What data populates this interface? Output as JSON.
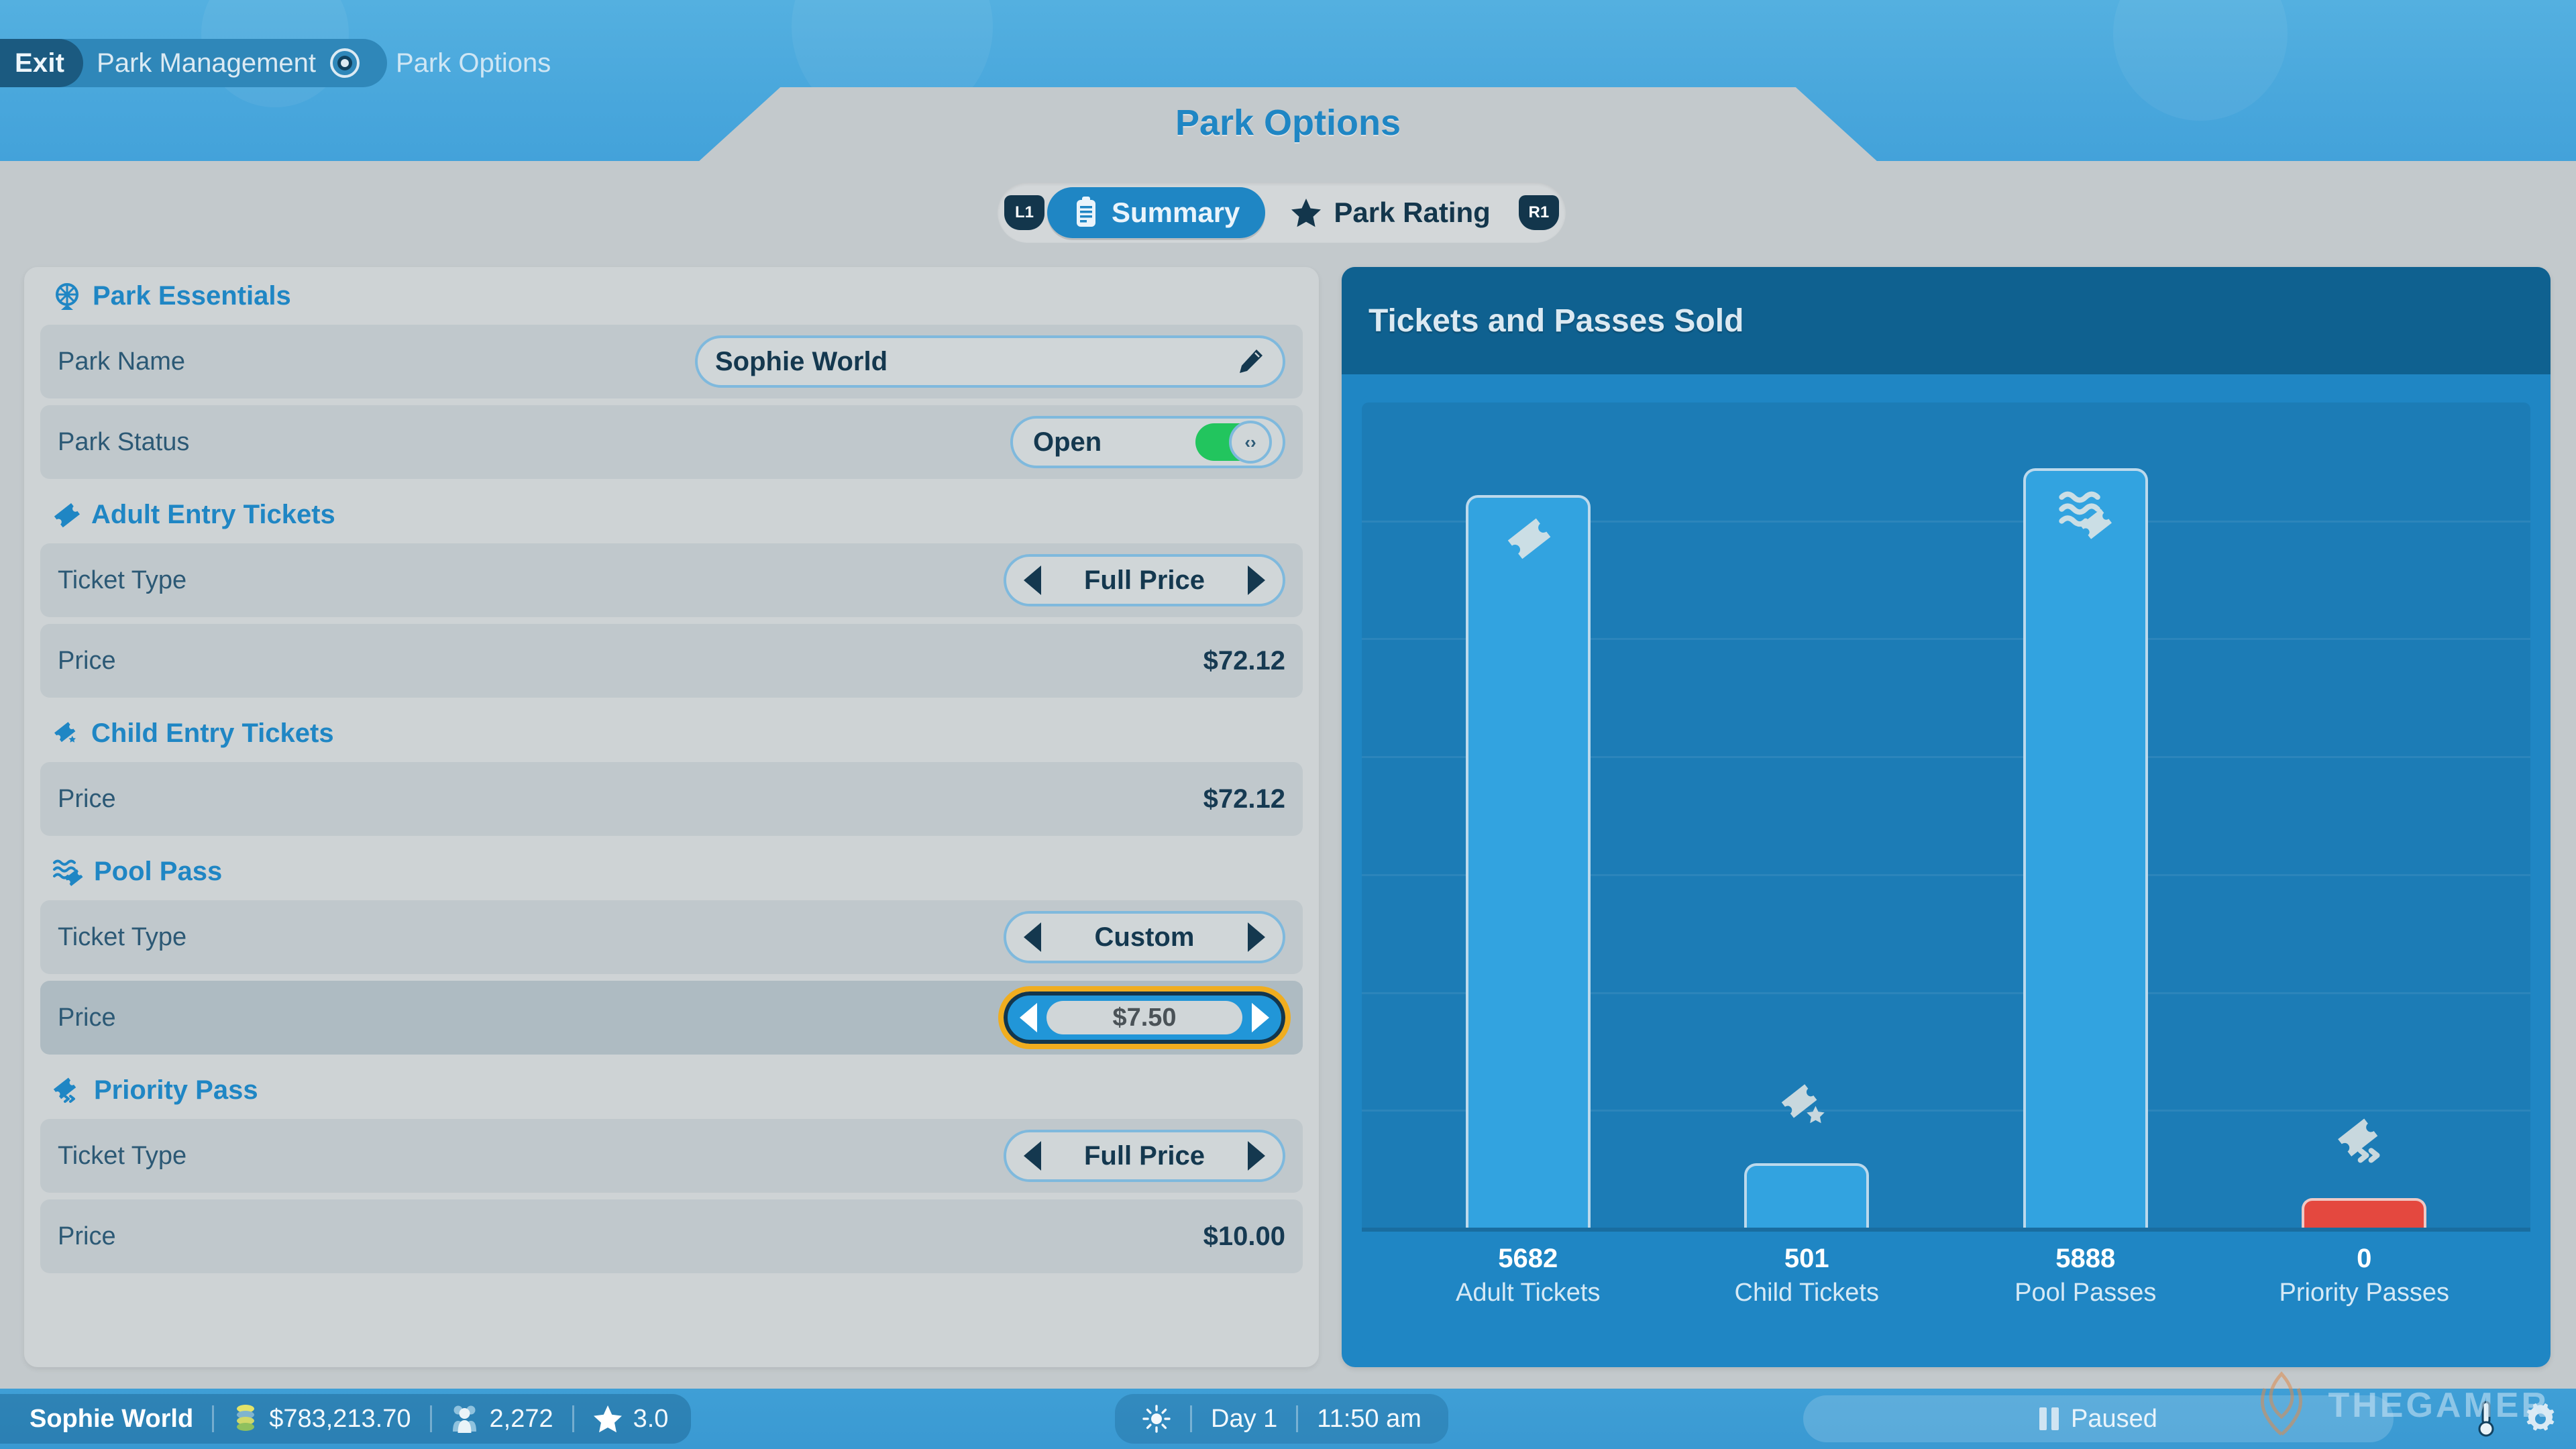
{
  "breadcrumb": {
    "exit_label": "Exit",
    "parent_label": "Park Management",
    "current_label": "Park Options",
    "separator_icon": "target-circle-icon"
  },
  "header": {
    "title": "Park Options"
  },
  "tabs": {
    "left_bumper": "L1",
    "right_bumper": "R1",
    "items": [
      {
        "label": "Summary",
        "icon": "clipboard-icon",
        "active": true
      },
      {
        "label": "Park Rating",
        "icon": "star-icon",
        "active": false
      }
    ]
  },
  "left_panel": {
    "sections": [
      {
        "title": "Park Essentials",
        "icon": "ferris-wheel-icon",
        "rows": [
          {
            "label": "Park Name",
            "control": "textfield",
            "value": "Sophie World",
            "trailing_icon": "pencil-icon"
          },
          {
            "label": "Park Status",
            "control": "toggle",
            "value": "Open",
            "toggle_on": true,
            "knob_glyph": "‹›"
          }
        ]
      },
      {
        "title": "Adult Entry Tickets",
        "icon": "ticket-icon",
        "rows": [
          {
            "label": "Ticket Type",
            "control": "stepper",
            "value": "Full Price"
          },
          {
            "label": "Price",
            "control": "static",
            "value": "$72.12"
          }
        ]
      },
      {
        "title": "Child Entry Tickets",
        "icon": "ticket-child-icon",
        "rows": [
          {
            "label": "Price",
            "control": "static",
            "value": "$72.12"
          }
        ]
      },
      {
        "title": "Pool Pass",
        "icon": "pool-ticket-icon",
        "rows": [
          {
            "label": "Ticket Type",
            "control": "stepper",
            "value": "Custom"
          },
          {
            "label": "Price",
            "control": "stepper-focused",
            "value": "$7.50",
            "selected": true
          }
        ]
      },
      {
        "title": "Priority Pass",
        "icon": "priority-ticket-icon",
        "rows": [
          {
            "label": "Ticket Type",
            "control": "stepper",
            "value": "Full Price"
          },
          {
            "label": "Price",
            "control": "static",
            "value": "$10.00"
          }
        ]
      }
    ]
  },
  "chart_panel": {
    "title": "Tickets and Passes Sold"
  },
  "chart_data": {
    "type": "bar",
    "title": "Tickets and Passes Sold",
    "xlabel": "",
    "ylabel": "",
    "categories": [
      "Adult Tickets",
      "Child Tickets",
      "Pool Passes",
      "Priority Passes"
    ],
    "values": [
      5682,
      501,
      5888,
      0
    ],
    "value_labels": [
      "5682",
      "501",
      "5888",
      "0"
    ],
    "bar_colors": [
      "#32a3e0",
      "#32a3e0",
      "#32a3e0",
      "#e4483f"
    ],
    "bar_icons": [
      "ticket-icon",
      "ticket-child-icon",
      "pool-ticket-icon",
      "priority-ticket-icon"
    ],
    "ylim": [
      0,
      6400
    ],
    "grid": true,
    "gridline_count": 6,
    "legend": "none"
  },
  "statusbar": {
    "park_name": "Sophie World",
    "money": "$783,213.70",
    "money_icon": "coins-icon",
    "guests": "2,272",
    "guests_icon": "people-icon",
    "rating": "3.0",
    "rating_icon": "star-icon",
    "weather_icon": "sun-icon",
    "day": "Day 1",
    "time": "11:50 am",
    "speed_state": "Paused",
    "speed_icon": "pause-icon",
    "thermometer_icon": "thermometer-icon",
    "settings_icon": "gear-icon"
  },
  "watermark": {
    "text": "THEGAMER",
    "icon": "thegamer-logo-icon"
  },
  "colors": {
    "sky": "#49a7dc",
    "panel_bg": "#c3c9cc",
    "accent_blue": "#1f86c4",
    "bar_blue": "#32a3e0",
    "bar_red": "#e4483f",
    "focus_gold": "#f0ad1f",
    "toggle_green": "#22c55e",
    "dark_navy": "#13364c"
  }
}
